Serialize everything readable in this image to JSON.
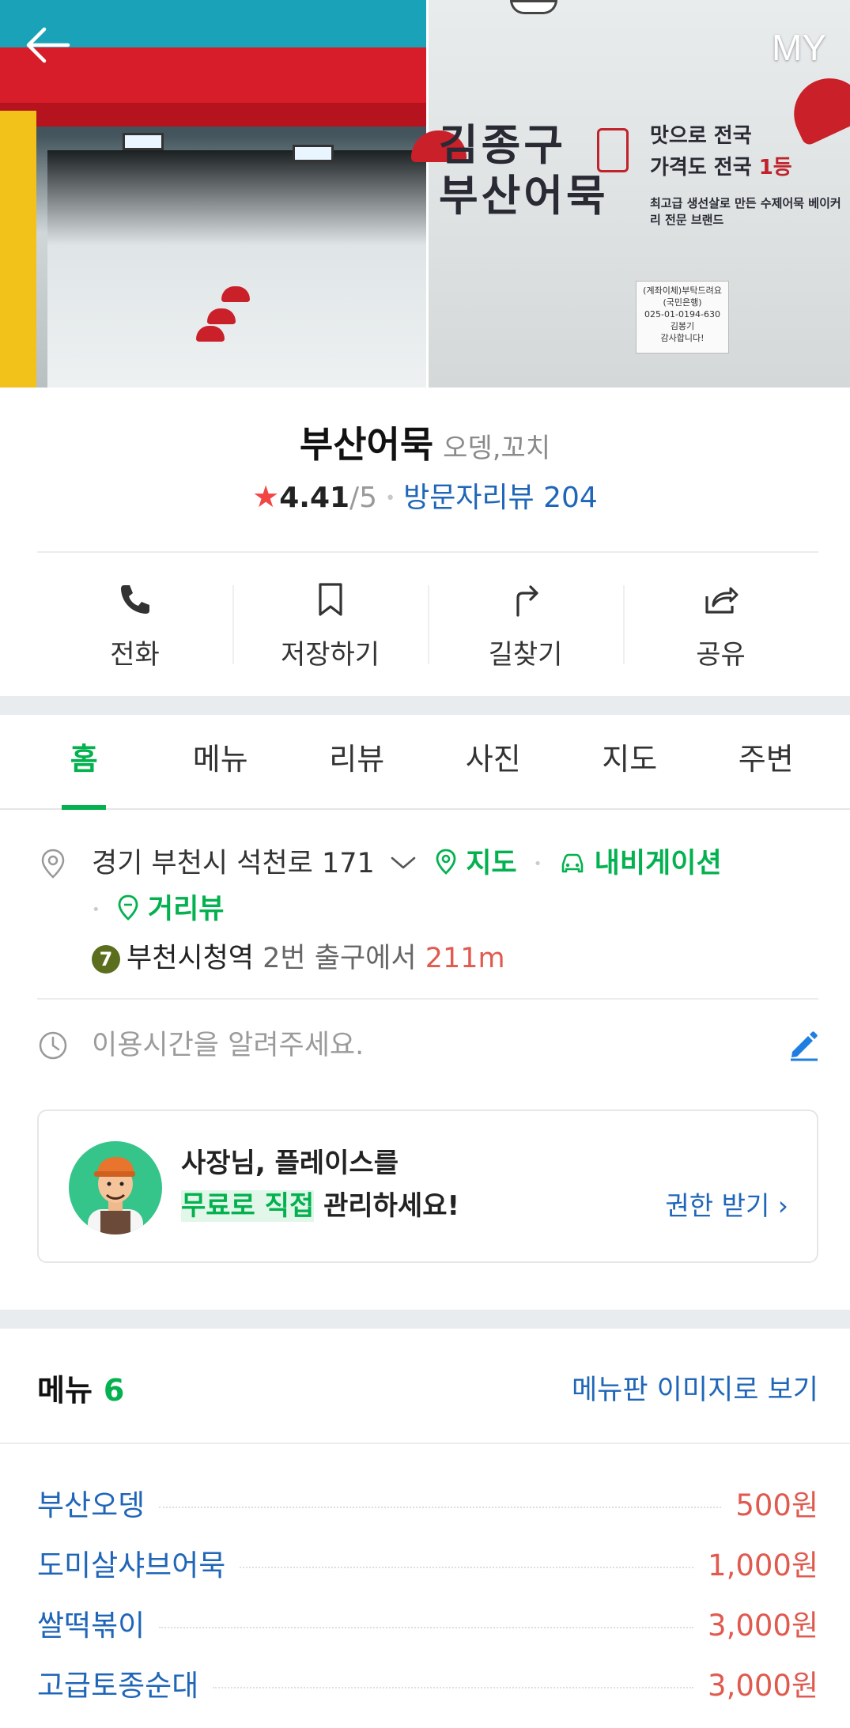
{
  "hero": {
    "back_icon": "arrow-left-icon",
    "my_label": "MY",
    "sign_main_1": "김종구",
    "sign_main_2": "부산어묵",
    "sign_sub_1": "맛으로 전국",
    "sign_sub_2": "가격도 전국",
    "sign_sub_2_red": "1등",
    "sign_small": "최고급 생선살로 만든 수제어묵 베이커리 전문 브랜드",
    "paper_note": [
      "(계좌이체)부탁드려요",
      "(국민은행)",
      "025-01-0194-630",
      "김봉기",
      "감사합니다!"
    ]
  },
  "place": {
    "name": "부산어묵",
    "category": "오뎅,꼬치",
    "rating": "4.41",
    "rating_max": "/5",
    "review_label": "방문자리뷰 204"
  },
  "actions": [
    {
      "label": "전화",
      "icon": "phone-icon"
    },
    {
      "label": "저장하기",
      "icon": "bookmark-icon"
    },
    {
      "label": "길찾기",
      "icon": "directions-icon"
    },
    {
      "label": "공유",
      "icon": "share-icon"
    }
  ],
  "tabs": [
    "홈",
    "메뉴",
    "리뷰",
    "사진",
    "지도",
    "주변"
  ],
  "active_tab": "홈",
  "info": {
    "address": "경기 부천시 석천로 171",
    "map_link": "지도",
    "navigation_link": "내비게이션",
    "streetview_link": "거리뷰",
    "subway_line": "7",
    "station": "부천시청역",
    "station_exit": "2번 출구에서",
    "distance": "211m",
    "hours_placeholder": "이용시간을 알려주세요."
  },
  "promo": {
    "line1": "사장님, 플레이스를",
    "highlight": "무료로 직접",
    "line2_rest": " 관리하세요!",
    "link": "권한 받기 ›"
  },
  "menu": {
    "title": "메뉴",
    "count": "6",
    "board_link": "메뉴판 이미지로 보기",
    "items": [
      {
        "name": "부산오뎅",
        "price": "500원"
      },
      {
        "name": "도미살샤브어묵",
        "price": "1,000원"
      },
      {
        "name": "쌀떡볶이",
        "price": "3,000원"
      },
      {
        "name": "고급토종순대",
        "price": "3,000원"
      }
    ]
  },
  "colors": {
    "accent_green": "#03b14f",
    "link_blue": "#1f66b8",
    "price_red": "#e05a4f",
    "star_red": "#f24646"
  }
}
